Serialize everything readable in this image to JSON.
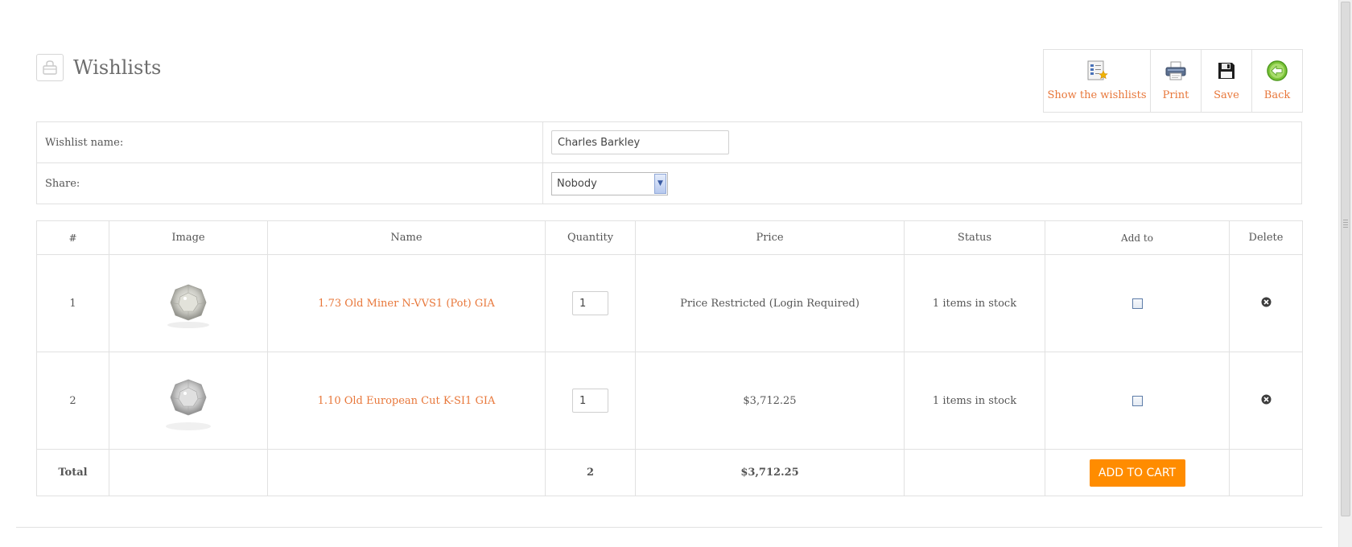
{
  "header": {
    "title": "Wishlists",
    "icon": "basket-icon"
  },
  "toolbar": {
    "show_wishlists": "Show the wishlists",
    "print": "Print",
    "save": "Save",
    "back": "Back"
  },
  "form": {
    "name_label": "Wishlist name:",
    "name_value": "Charles Barkley",
    "share_label": "Share:",
    "share_value": "Nobody"
  },
  "table": {
    "headers": {
      "num": "#",
      "image": "Image",
      "name": "Name",
      "quantity": "Quantity",
      "price": "Price",
      "status": "Status",
      "add_to": "Add to",
      "delete": "Delete"
    },
    "rows": [
      {
        "num": "1",
        "name": "1.73 Old Miner N-VVS1 (Pot) GIA",
        "quantity": "1",
        "price": "Price Restricted (Login Required)",
        "status": "1 items in stock"
      },
      {
        "num": "2",
        "name": "1.10 Old European Cut K-SI1 GIA",
        "quantity": "1",
        "price": "$3,712.25",
        "status": "1 items in stock"
      }
    ],
    "total": {
      "label": "Total",
      "quantity": "2",
      "price": "$3,712.25",
      "button": "ADD TO CART"
    }
  },
  "colors": {
    "accent": "#e8773a",
    "stock": "#6a9a2a",
    "cart_button": "#ff8c00",
    "border": "#e1e1e1"
  }
}
